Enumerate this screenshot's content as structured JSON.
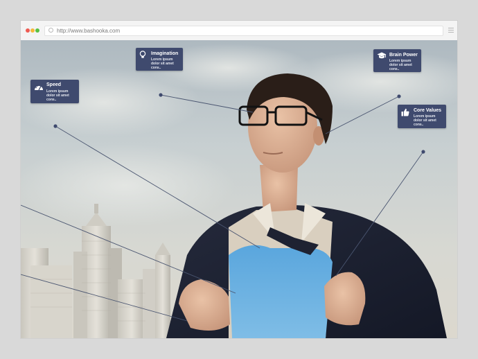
{
  "browser": {
    "url": "http://www.bashooka.com",
    "controls": [
      "close-dot",
      "minimize-dot",
      "maximize-dot"
    ]
  },
  "callouts": {
    "imagination": {
      "title": "Imagination",
      "body_line1": "Lorem ipsum",
      "body_line2": "dolor sit amet",
      "body_line3": "cons..",
      "icon": "lightbulb-icon"
    },
    "brain_power": {
      "title": "Brain Power",
      "body_line1": "Lorem ipsum",
      "body_line2": "dolor sit amet",
      "body_line3": "cons..",
      "icon": "graduation-cap-icon"
    },
    "speed": {
      "title": "Speed",
      "body_line1": "Lorem ipsum",
      "body_line2": "dolor sit amet",
      "body_line3": "cons..",
      "icon": "speedometer-icon"
    },
    "core_values": {
      "title": "Core Values",
      "body_line1": "Lorem ipsum",
      "body_line2": "dolor sit amet",
      "body_line3": "cons..",
      "icon": "thumbs-up-icon"
    }
  },
  "colors": {
    "callout_bg": "#3f4a6e",
    "connector": "#4a5570",
    "dot_red": "#ee5b52",
    "dot_yellow": "#f5b93a",
    "dot_green": "#58c043"
  }
}
